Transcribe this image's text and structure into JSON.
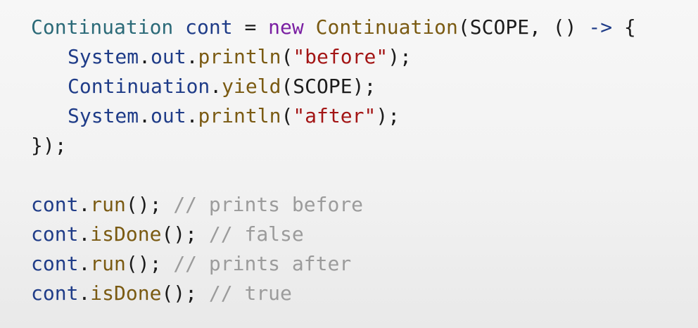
{
  "lines": [
    {
      "indent": false,
      "tokens": [
        {
          "t": "Continuation",
          "k": "type"
        },
        {
          "t": " ",
          "k": "punc"
        },
        {
          "t": "cont",
          "k": "var"
        },
        {
          "t": " = ",
          "k": "punc"
        },
        {
          "t": "new",
          "k": "kw"
        },
        {
          "t": " ",
          "k": "punc"
        },
        {
          "t": "Continuation",
          "k": "fn"
        },
        {
          "t": "(SCOPE, () ",
          "k": "punc"
        },
        {
          "t": "->",
          "k": "op"
        },
        {
          "t": " {",
          "k": "punc"
        }
      ]
    },
    {
      "indent": true,
      "tokens": [
        {
          "t": "System",
          "k": "var"
        },
        {
          "t": ".",
          "k": "punc"
        },
        {
          "t": "out",
          "k": "var"
        },
        {
          "t": ".",
          "k": "punc"
        },
        {
          "t": "println",
          "k": "fn"
        },
        {
          "t": "(",
          "k": "punc"
        },
        {
          "t": "\"before\"",
          "k": "str"
        },
        {
          "t": ");",
          "k": "punc"
        }
      ]
    },
    {
      "indent": true,
      "tokens": [
        {
          "t": "Continuation",
          "k": "var"
        },
        {
          "t": ".",
          "k": "punc"
        },
        {
          "t": "yield",
          "k": "fn"
        },
        {
          "t": "(SCOPE);",
          "k": "punc"
        }
      ]
    },
    {
      "indent": true,
      "tokens": [
        {
          "t": "System",
          "k": "var"
        },
        {
          "t": ".",
          "k": "punc"
        },
        {
          "t": "out",
          "k": "var"
        },
        {
          "t": ".",
          "k": "punc"
        },
        {
          "t": "println",
          "k": "fn"
        },
        {
          "t": "(",
          "k": "punc"
        },
        {
          "t": "\"after\"",
          "k": "str"
        },
        {
          "t": ");",
          "k": "punc"
        }
      ]
    },
    {
      "indent": false,
      "tokens": [
        {
          "t": "});",
          "k": "punc"
        }
      ]
    },
    {
      "blank": true,
      "tokens": []
    },
    {
      "indent": false,
      "tokens": [
        {
          "t": "cont",
          "k": "var"
        },
        {
          "t": ".",
          "k": "punc"
        },
        {
          "t": "run",
          "k": "fn"
        },
        {
          "t": "(); ",
          "k": "punc"
        },
        {
          "t": "// prints before",
          "k": "comment"
        }
      ]
    },
    {
      "indent": false,
      "tokens": [
        {
          "t": "cont",
          "k": "var"
        },
        {
          "t": ".",
          "k": "punc"
        },
        {
          "t": "isDone",
          "k": "fn"
        },
        {
          "t": "(); ",
          "k": "punc"
        },
        {
          "t": "// false",
          "k": "comment"
        }
      ]
    },
    {
      "indent": false,
      "tokens": [
        {
          "t": "cont",
          "k": "var"
        },
        {
          "t": ".",
          "k": "punc"
        },
        {
          "t": "run",
          "k": "fn"
        },
        {
          "t": "(); ",
          "k": "punc"
        },
        {
          "t": "// prints after",
          "k": "comment"
        }
      ]
    },
    {
      "indent": false,
      "tokens": [
        {
          "t": "cont",
          "k": "var"
        },
        {
          "t": ".",
          "k": "punc"
        },
        {
          "t": "isDone",
          "k": "fn"
        },
        {
          "t": "(); ",
          "k": "punc"
        },
        {
          "t": "// true",
          "k": "comment"
        }
      ]
    }
  ]
}
